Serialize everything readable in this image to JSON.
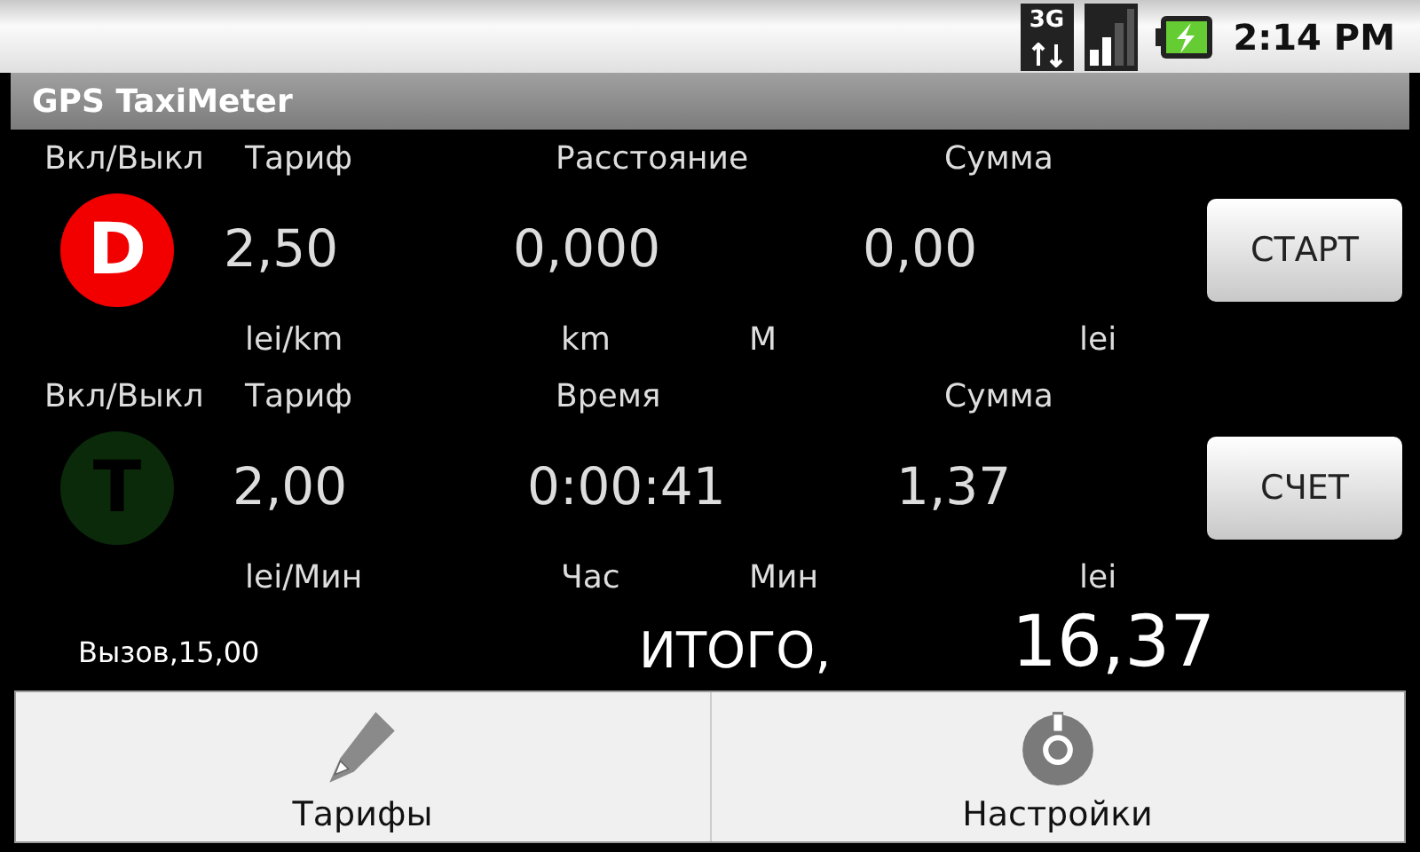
{
  "status_bar": {
    "network": "3G",
    "time": "2:14 PM"
  },
  "window": {
    "title": "GPS TaxiMeter"
  },
  "meters": [
    {
      "toggle_label": "Вкл/Выкл",
      "letter": "D",
      "on": true,
      "color": "#f20000",
      "tariff_label": "Тариф",
      "tariff_value": "2,50",
      "tariff_unit": "lei/km",
      "measure_label": "Расстояние",
      "measure_value": "0,000",
      "measure_unit": "km",
      "sub_unit": "M",
      "sum_label": "Сумма",
      "sum_value": "0,00",
      "sum_unit": "lei",
      "button": "СТАРТ"
    },
    {
      "toggle_label": "Вкл/Выкл",
      "letter": "T",
      "on": false,
      "color": "#0a2a0a",
      "tariff_label": "Тариф",
      "tariff_value": "2,00",
      "tariff_unit": "lei/Мин",
      "measure_label": "Время",
      "measure_value": "0:00:41",
      "measure_unit": "Час",
      "sub_unit": "Мин",
      "sum_label": "Сумма",
      "sum_value": "1,37",
      "sum_unit": "lei",
      "button": "СЧЕТ"
    }
  ],
  "totals": {
    "call_fee": "Вызов,15,00",
    "total_label": "ИТОГО,",
    "total_value": "16,37"
  },
  "menu": [
    {
      "label": "Тарифы",
      "kind": "pencil"
    },
    {
      "label": "Настройки",
      "kind": "gear"
    }
  ]
}
